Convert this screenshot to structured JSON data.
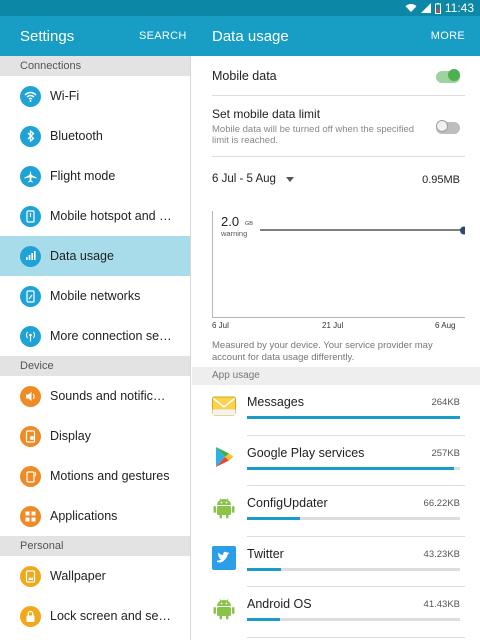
{
  "status_bar": {
    "time": "11:43"
  },
  "header": {
    "left_title": "Settings",
    "left_action": "SEARCH",
    "right_title": "Data usage",
    "right_action": "MORE"
  },
  "colors": {
    "accent": "#189ec4",
    "status_bar": "#0d87a6",
    "toggle_on": "#4caf50",
    "active_row": "#a9dcea",
    "usage_bar": "#1a9cc8"
  },
  "sidebar": {
    "sections": [
      {
        "header": "Connections",
        "items": [
          {
            "label": "Wi-Fi",
            "icon": "wifi-icon",
            "color": "#1fa3d6"
          },
          {
            "label": "Bluetooth",
            "icon": "bluetooth-icon",
            "color": "#1fa3d6"
          },
          {
            "label": "Flight mode",
            "icon": "airplane-icon",
            "color": "#1fa3d6"
          },
          {
            "label": "Mobile hotspot and tet..",
            "icon": "hotspot-icon",
            "color": "#1fa3d6"
          },
          {
            "label": "Data usage",
            "icon": "data-usage-icon",
            "color": "#1fa3d6",
            "active": true
          },
          {
            "label": "Mobile networks",
            "icon": "mobile-networks-icon",
            "color": "#1fa3d6"
          },
          {
            "label": "More connection settin..",
            "icon": "more-connections-icon",
            "color": "#1fa3d6"
          }
        ]
      },
      {
        "header": "Device",
        "items": [
          {
            "label": "Sounds and notification..",
            "icon": "sound-icon",
            "color": "#f08a24"
          },
          {
            "label": "Display",
            "icon": "display-icon",
            "color": "#f08a24"
          },
          {
            "label": "Motions and gestures",
            "icon": "motion-icon",
            "color": "#f08a24"
          },
          {
            "label": "Applications",
            "icon": "applications-icon",
            "color": "#f08a24"
          }
        ]
      },
      {
        "header": "Personal",
        "items": [
          {
            "label": "Wallpaper",
            "icon": "wallpaper-icon",
            "color": "#f2a81d"
          },
          {
            "label": "Lock screen and securi..",
            "icon": "lock-icon",
            "color": "#f2a81d"
          }
        ]
      }
    ]
  },
  "main": {
    "mobile_data": {
      "label": "Mobile data",
      "on": true
    },
    "data_limit": {
      "label": "Set mobile data limit",
      "description": "Mobile data will be turned off when the specified limit is reached.",
      "on": false
    },
    "range": {
      "label": "6 Jul - 5 Aug",
      "amount": "0.95MB"
    },
    "chart": {
      "warning_value": "2.0",
      "warning_unit": "GB",
      "warning_label": "warning",
      "x_labels": [
        "6 Jul",
        "21 Jul",
        "6 Aug"
      ]
    },
    "note": "Measured by your device. Your service provider may account for data usage differently.",
    "app_usage_header": "App usage",
    "apps": [
      {
        "name": "Messages",
        "size": "264KB",
        "icon": "messages-icon",
        "fraction": 1.0
      },
      {
        "name": "Google Play services",
        "size": "257KB",
        "icon": "google-play-services-icon",
        "fraction": 0.97
      },
      {
        "name": "ConfigUpdater",
        "size": "66.22KB",
        "icon": "android-icon",
        "fraction": 0.25
      },
      {
        "name": "Twitter",
        "size": "43.23KB",
        "icon": "twitter-icon",
        "fraction": 0.16
      },
      {
        "name": "Android OS",
        "size": "41.43KB",
        "icon": "android-icon",
        "fraction": 0.155
      }
    ]
  }
}
